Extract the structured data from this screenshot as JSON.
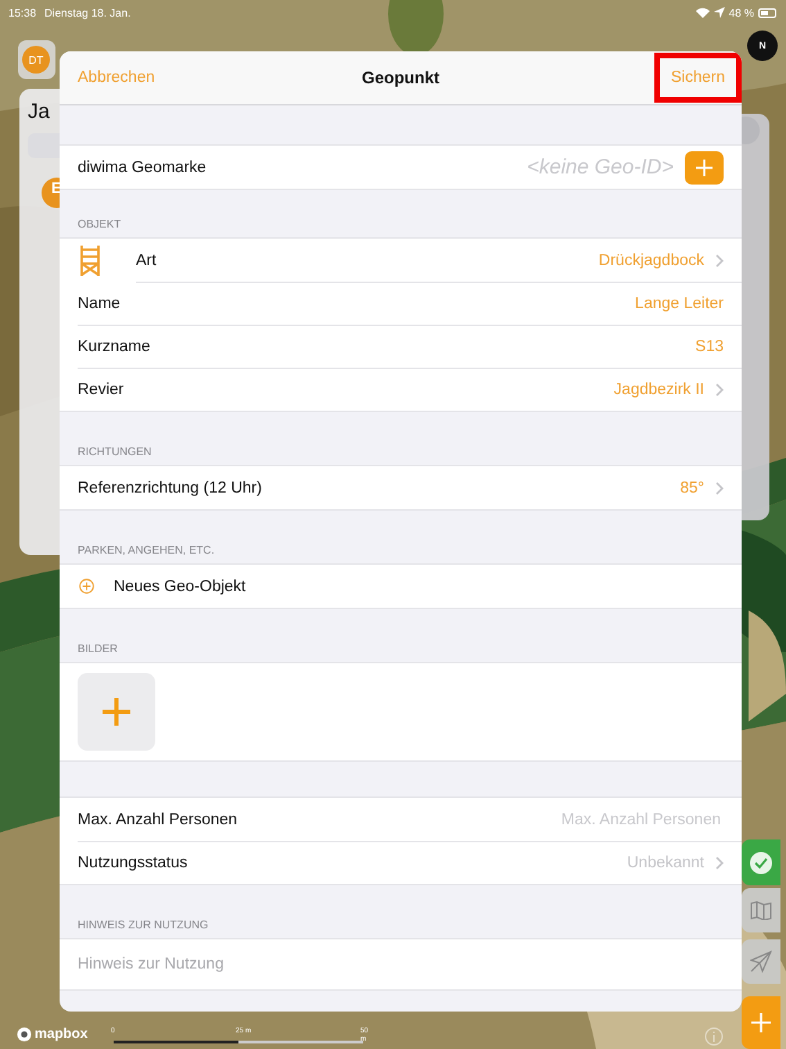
{
  "status_bar": {
    "time": "15:38",
    "date": "Dienstag 18. Jan.",
    "battery": "48 %"
  },
  "background_panel": {
    "avatar": "DT",
    "title": "Ja",
    "badge": "E"
  },
  "compass": {
    "label": "N"
  },
  "map": {
    "logo": "mapbox",
    "scale_labels": [
      "0",
      "25 m",
      "50 m"
    ]
  },
  "map_buttons": [
    {
      "kind": "confirm"
    },
    {
      "kind": "map"
    },
    {
      "kind": "location"
    },
    {
      "kind": "add"
    }
  ],
  "sheet": {
    "title": "Geopunkt",
    "cancel": "Abbrechen",
    "save": {
      "label": "Sichern",
      "highlighted": true
    }
  },
  "sections": [
    {
      "rows": [
        {
          "kind": "tag",
          "label": "diwima Geomarke",
          "value": "<keine Geo-ID>"
        }
      ]
    },
    {
      "header": "OBJEKT",
      "rows": [
        {
          "kind": "icon",
          "label": "Art",
          "value": "Drückjagdbock",
          "disclosure": true
        },
        {
          "kind": "value",
          "label": "Name",
          "value": "Lange Leiter",
          "disclosure": false
        },
        {
          "kind": "value",
          "label": "Kurzname",
          "value": "S13",
          "disclosure": false
        },
        {
          "kind": "value",
          "label": "Revier",
          "value": "Jagdbezirk II",
          "disclosure": true
        }
      ]
    },
    {
      "header": "RICHTUNGEN",
      "rows": [
        {
          "kind": "value",
          "label": "Referenzrichtung (12 Uhr)",
          "value": "85°",
          "disclosure": true
        }
      ]
    },
    {
      "header": "PARKEN, ANGEHEN, ETC.",
      "rows": [
        {
          "kind": "add",
          "label": "Neues Geo-Objekt"
        }
      ]
    },
    {
      "header": "BILDER",
      "rows": [
        {
          "kind": "images"
        }
      ]
    },
    {
      "rows": [
        {
          "kind": "input",
          "label": "Max. Anzahl Personen",
          "placeholder": "Max. Anzahl Personen"
        },
        {
          "kind": "muted",
          "label": "Nutzungsstatus",
          "value": "Unbekannt",
          "disclosure": true
        }
      ]
    },
    {
      "header": "HINWEIS ZUR NUTZUNG",
      "rows": [
        {
          "kind": "textarea",
          "placeholder": "Hinweis zur Nutzung"
        }
      ]
    }
  ]
}
